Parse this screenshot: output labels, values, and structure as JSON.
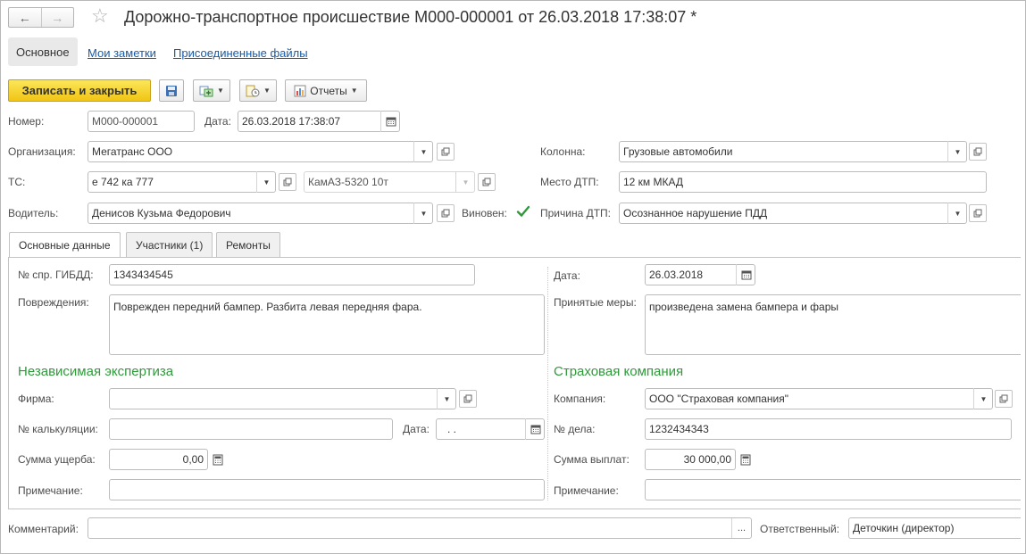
{
  "window": {
    "title": "Дорожно-транспортное происшествие  М000-000001 от 26.03.2018 17:38:07 *"
  },
  "nav": {
    "back": "←",
    "forward": "→",
    "star": "☆"
  },
  "tabs": {
    "main": "Основное",
    "notes": "Мои заметки",
    "files": "Присоединенные файлы"
  },
  "toolbar": {
    "save_close": "Записать и закрыть",
    "reports": "Отчеты"
  },
  "header": {
    "number_label": "Номер:",
    "number_value": "М000-000001",
    "date_label": "Дата:",
    "date_value": "26.03.2018 17:38:07",
    "org_label": "Организация:",
    "org_value": "Мегатранс ООО",
    "column_label": "Колонна:",
    "column_value": "Грузовые автомобили",
    "ts_label": "ТС:",
    "ts_value": "е 742 ка 777",
    "ts_model_value": "КамАЗ-5320 10т",
    "place_label": "Место ДТП:",
    "place_value": "12 км МКАД",
    "driver_label": "Водитель:",
    "driver_value": "Денисов Кузьма Федорович",
    "guilty_label": "Виновен:",
    "guilty_checked": true,
    "reason_label": "Причина ДТП:",
    "reason_value": "Осознанное нарушение ПДД"
  },
  "inner_tabs": [
    "Основные данные",
    "Участники (1)",
    "Ремонты"
  ],
  "main_data": {
    "gibdd_label": "№ спр. ГИБДД:",
    "gibdd_value": "1343434545",
    "damage_label": "Повреждения:",
    "damage_value": "Поврежден передний бампер. Разбита левая передняя фара.",
    "date_label": "Дата:",
    "date_value": "26.03.2018",
    "measures_label": "Принятые меры:",
    "measures_value": "произведена замена бампера и фары"
  },
  "expertise": {
    "title": "Независимая экспертиза",
    "firm_label": "Фирма:",
    "firm_value": "",
    "calc_label": "№ калькуляции:",
    "calc_value": "",
    "date_label": "Дата:",
    "date_value": " .  .",
    "damage_sum_label": "Сумма ущерба:",
    "damage_sum_value": "0,00",
    "note_label": "Примечание:",
    "note_value": ""
  },
  "insurance": {
    "title": "Страховая компания",
    "company_label": "Компания:",
    "company_value": "ООО \"Страховая компания\"",
    "case_label": "№ дела:",
    "case_value": "1232434343",
    "payout_label": "Сумма выплат:",
    "payout_value": "30 000,00",
    "note_label": "Примечание:",
    "note_value": ""
  },
  "footer": {
    "comment_label": "Комментарий:",
    "comment_value": "",
    "comment_btn": "...",
    "responsible_label": "Ответственный:",
    "responsible_value": "Деточкин (директор)"
  },
  "colors": {
    "primary_button": "#f1c514",
    "link": "#1a5aa6",
    "section_title": "#2e9a3a",
    "check": "#2e9a3a"
  }
}
